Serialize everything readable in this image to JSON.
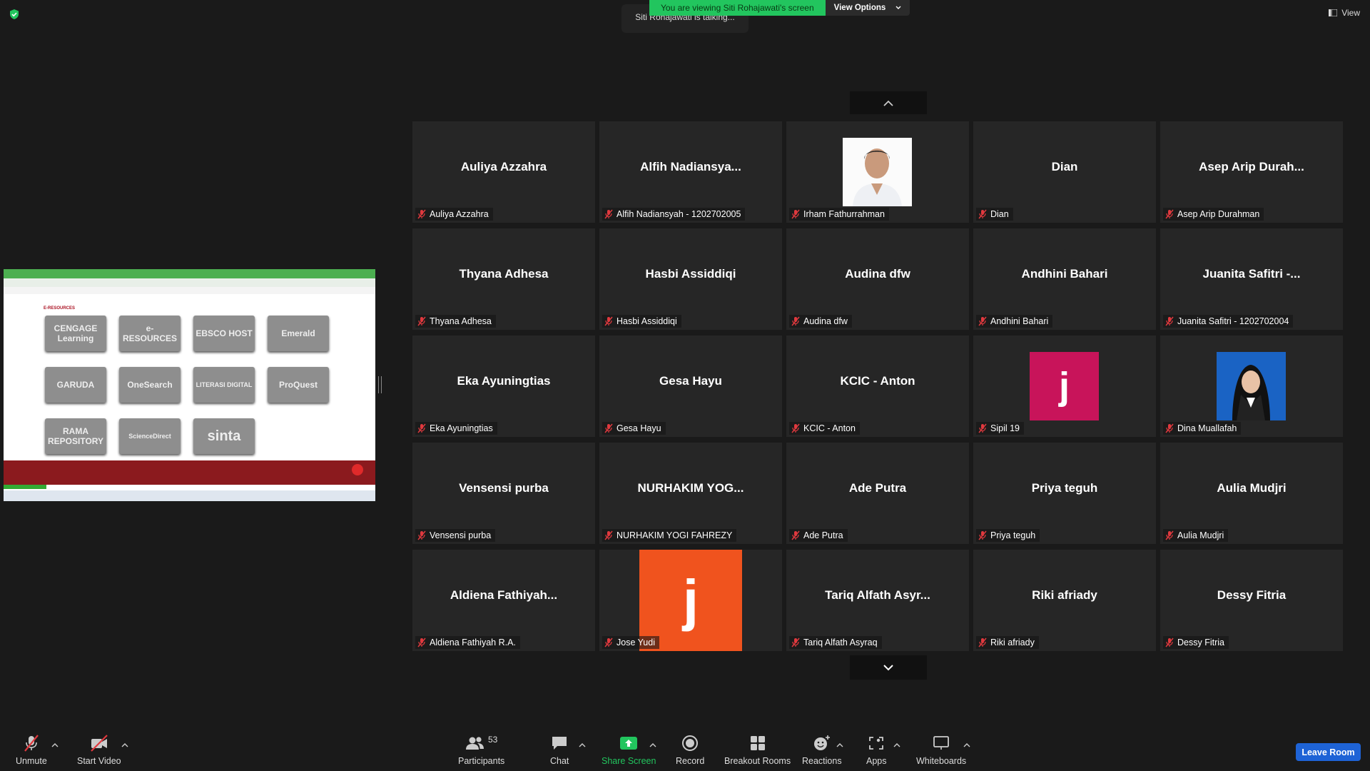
{
  "top": {
    "viewing_banner": "You are viewing Siti Rohajawati's screen",
    "view_options": "View Options",
    "talking": "Siti Rohajawati is talking...",
    "view_label": "View"
  },
  "shared_screen": {
    "section_title": "E-RESOURCES",
    "logos": [
      "CENGAGE Learning",
      "e-RESOURCES",
      "EBSCO HOST",
      "Emerald",
      "GARUDA",
      "OneSearch",
      "LITERASI DIGITAL",
      "ProQuest",
      "RAMA REPOSITORY",
      "ScienceDirect",
      "sinta"
    ]
  },
  "participants": [
    {
      "big": "Auliya Azzahra",
      "label": "Auliya Azzahra"
    },
    {
      "big": "Alfih  Nadiansya...",
      "label": "Alfih Nadiansyah - 1202702005"
    },
    {
      "big": "",
      "label": "Irham Fathurrahman",
      "photo": "man-portrait"
    },
    {
      "big": "Dian",
      "label": "Dian"
    },
    {
      "big": "Asep  Arip  Durah...",
      "label": "Asep Arip Durahman"
    },
    {
      "big": "Thyana Adhesa",
      "label": "Thyana Adhesa"
    },
    {
      "big": "Hasbi Assiddiqi",
      "label": "Hasbi Assiddiqi"
    },
    {
      "big": "Audina dfw",
      "label": "Audina dfw"
    },
    {
      "big": "Andhini Bahari",
      "label": "Andhini Bahari"
    },
    {
      "big": "Juanita Safitri -...",
      "label": "Juanita Safitri - 1202702004"
    },
    {
      "big": "Eka Ayuningtias",
      "label": "Eka Ayuningtias"
    },
    {
      "big": "Gesa Hayu",
      "label": "Gesa Hayu"
    },
    {
      "big": "KCIC - Anton",
      "label": "KCIC - Anton"
    },
    {
      "big": "",
      "label": "Sipil 19",
      "avatar": "j"
    },
    {
      "big": "",
      "label": "Dina Muallafah",
      "photo": "woman-portrait"
    },
    {
      "big": "Vensensi purba",
      "label": "Vensensi purba"
    },
    {
      "big": "NURHAKIM  YOG...",
      "label": "NURHAKIM YOGI FAHREZY"
    },
    {
      "big": "Ade Putra",
      "label": "Ade Putra"
    },
    {
      "big": "Priya teguh",
      "label": "Priya teguh"
    },
    {
      "big": "Aulia Mudjri",
      "label": "Aulia Mudjri"
    },
    {
      "big": "Aldiena  Fathiyah...",
      "label": "Aldiena Fathiyah R.A."
    },
    {
      "big": "",
      "label": "Jose Yudi",
      "avatar": "j"
    },
    {
      "big": "Tariq  Alfath  Asyr...",
      "label": "Tariq Alfath Asyraq"
    },
    {
      "big": "Riki afriady",
      "label": "Riki afriady"
    },
    {
      "big": "Dessy Fitria",
      "label": "Dessy Fitria"
    }
  ],
  "toolbar": {
    "unmute": "Unmute",
    "start_video": "Start Video",
    "participants": "Participants",
    "participants_count": "53",
    "chat": "Chat",
    "share_screen": "Share Screen",
    "record": "Record",
    "breakout_rooms": "Breakout Rooms",
    "reactions": "Reactions",
    "apps": "Apps",
    "whiteboards": "Whiteboards",
    "leave_room": "Leave Room"
  },
  "colors": {
    "share_green": "#22c55e",
    "avatar_pink": "#c8145a",
    "avatar_orange": "#f0531e",
    "leave_blue": "#1e63d6",
    "muted_red": "#e0393e"
  }
}
